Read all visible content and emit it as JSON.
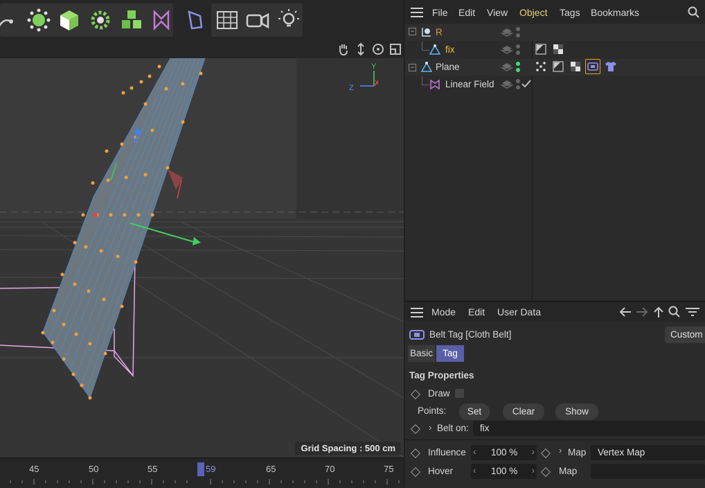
{
  "toolbar": {
    "icons": [
      "pen-icon",
      "point-mode-icon",
      "cube-icon",
      "gear-cloner-icon",
      "stack-icon",
      "field-icon",
      "deformer-icon",
      "floor-grid-icon",
      "camera-icon",
      "light-icon"
    ]
  },
  "viewport": {
    "grid_spacing": "Grid Spacing : 500 cm",
    "axis_y": "Y",
    "axis_z": "Z",
    "axis_x": "X"
  },
  "timeline": {
    "labels": [
      "45",
      "50",
      "55",
      "59",
      "65",
      "70",
      "75"
    ],
    "current_frame": "59"
  },
  "object_manager": {
    "menu": [
      "File",
      "Edit",
      "View",
      "Object",
      "Tags",
      "Bookmarks"
    ],
    "active_menu": "Object",
    "objects": [
      {
        "name": "R",
        "color": "#e89a3c"
      },
      {
        "name": "fix",
        "color": "#f0c030"
      },
      {
        "name": "Plane",
        "color": "#d8d8d8"
      },
      {
        "name": "Linear Field",
        "color": "#d8d8d8"
      }
    ]
  },
  "attribute_manager": {
    "menu": [
      "Mode",
      "Edit",
      "User Data"
    ],
    "title": "Belt Tag [Cloth Belt]",
    "custom_button": "Custom",
    "tabs": [
      "Basic",
      "Tag"
    ],
    "active_tab": "Tag",
    "section_title": "Tag Properties",
    "draw_label": "Draw",
    "points_label": "Points:",
    "buttons": [
      "Set",
      "Clear",
      "Show"
    ],
    "belt_on_label": "Belt on:",
    "belt_on_value": "fix",
    "influence_label": "Influence",
    "influence_value": "100 %",
    "map_label": "Map",
    "map_value": "Vertex Map",
    "hover_label": "Hover",
    "hover_value": "100 %",
    "map2_label": "Map",
    "map2_value": ""
  }
}
